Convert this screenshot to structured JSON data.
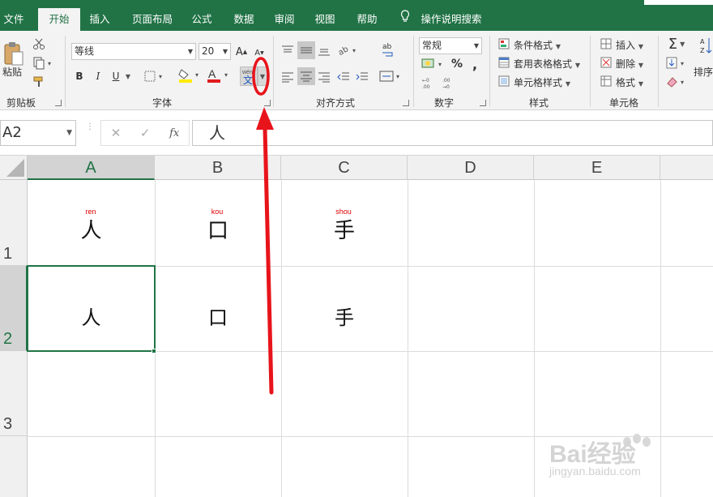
{
  "menu": {
    "tabs": [
      "文件",
      "开始",
      "插入",
      "页面布局",
      "公式",
      "数据",
      "审阅",
      "视图",
      "帮助",
      "操作说明搜索"
    ],
    "active_tab": "开始"
  },
  "ribbon": {
    "clipboard": {
      "paste_label": "粘贴",
      "group_label": "剪贴板"
    },
    "font": {
      "font_name": "等线",
      "font_size": "20",
      "bold": "B",
      "italic": "I",
      "underline": "U",
      "font_color_glyph": "A",
      "phonetic_glyph": "wén",
      "group_label": "字体"
    },
    "alignment": {
      "group_label": "对齐方式"
    },
    "number": {
      "format": "常规",
      "percent": "%",
      "comma": ",",
      "group_label": "数字"
    },
    "styles": {
      "conditional": "条件格式",
      "table_format": "套用表格格式",
      "cell_styles": "单元格样式",
      "group_label": "样式"
    },
    "cells": {
      "insert": "插入",
      "delete": "删除",
      "format": "格式",
      "group_label": "单元格"
    },
    "editing": {
      "sort": "排序"
    }
  },
  "formula_bar": {
    "name_box": "A2",
    "fx": "fx",
    "content": "人"
  },
  "sheet": {
    "columns": [
      "A",
      "B",
      "C",
      "D",
      "E"
    ],
    "rows": [
      "1",
      "2",
      "3"
    ],
    "row1": [
      {
        "ruby": "ren",
        "char": "人"
      },
      {
        "ruby": "kou",
        "char": "口"
      },
      {
        "ruby": "shou",
        "char": "手"
      }
    ],
    "row2": [
      "人",
      "口",
      "手"
    ],
    "selected_cell": "A2"
  },
  "watermark": {
    "brand": "Bai经验",
    "url": "jingyan.baidu.com"
  },
  "colors": {
    "excel_green": "#217346",
    "annotation_red": "#e8141b",
    "ruby_red": "#dd0000"
  }
}
